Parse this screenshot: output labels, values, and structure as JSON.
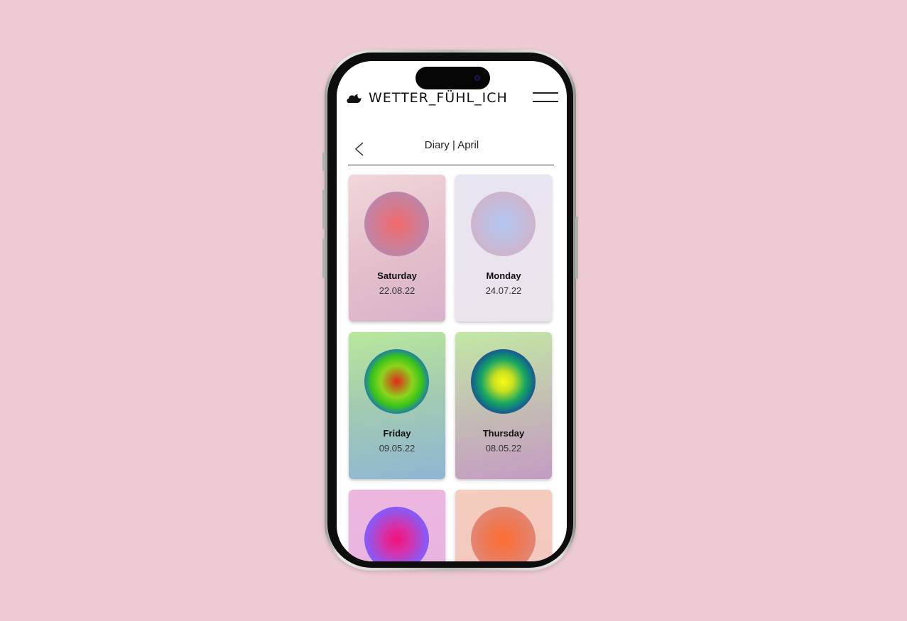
{
  "app": {
    "title": "WETTER_FÜHL_ICH"
  },
  "diary": {
    "title": "Diary | April"
  },
  "cards": [
    {
      "day": "Saturday",
      "date": "22.08.22"
    },
    {
      "day": "Monday",
      "date": "24.07.22"
    },
    {
      "day": "Friday",
      "date": "09.05.22"
    },
    {
      "day": "Thursday",
      "date": "08.05.22"
    },
    {
      "day": "",
      "date": ""
    },
    {
      "day": "",
      "date": ""
    }
  ],
  "colors": {
    "page_background": "#eccbd2",
    "screen_background": "#ffffff"
  },
  "icons": {
    "logo": "cloud-moon-icon",
    "menu": "hamburger-menu-icon",
    "back": "chevron-left-icon"
  }
}
